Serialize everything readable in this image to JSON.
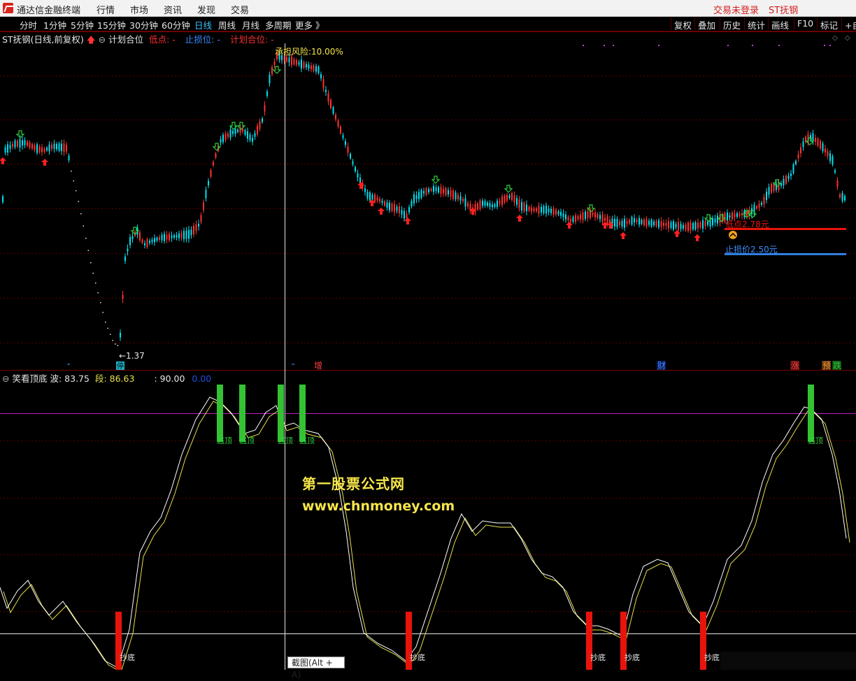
{
  "app": {
    "title": "通达信金融终端",
    "menu": [
      "行情",
      "市场",
      "资讯",
      "发现",
      "交易"
    ],
    "login_status": "交易未登录",
    "stock_name": "ST抚钢"
  },
  "timeframes": [
    "分时",
    "1分钟",
    "5分钟",
    "15分钟",
    "30分钟",
    "60分钟",
    "日线",
    "周线",
    "月线",
    "多周期",
    "更多 》"
  ],
  "active_timeframe": "日线",
  "tools": [
    "复权",
    "叠加",
    "历史",
    "统计",
    "画线",
    "F10",
    "标记",
    "+自"
  ],
  "main_panel": {
    "stock_label": "ST抚钢(日线,前复权)",
    "indicator_name": "计划合位",
    "low_label": "低点: -",
    "stop_label": "止损位: -",
    "plan_label": "计划合位: -",
    "top_annotation": "承担风险:10.00%",
    "min_annotation": "←1.37",
    "low_price_label": "低点2.78元",
    "stop_price_label": "止损价2.50元",
    "event_tags": [
      {
        "text": "停",
        "color": "#1ab0c4"
      },
      {
        "text": "增",
        "color": "#ff4040"
      },
      {
        "text": "财",
        "color": "#3b8cff"
      },
      {
        "text": "涨",
        "color": "#ff4040"
      },
      {
        "text": "预",
        "color": "#ff9933"
      },
      {
        "text": "跌",
        "color": "#2ed03a"
      }
    ],
    "candles_color_up": "#ff3232",
    "candles_color_down": "#00e0f0"
  },
  "sub_panel": {
    "indicator_name": "笑看顶底",
    "wave_label": "波:",
    "wave_value": "83.75",
    "segment_label": "段:",
    "segment_value": "86.63",
    "level_label": ": 90.00",
    "zero_label": "0.00",
    "top_signal_text": "逃顶",
    "bottom_signal_text": "抄底",
    "line_wave_color": "#ffffff",
    "line_segment_color": "#e6e04a",
    "top_bar_color": "#34c234",
    "bottom_bar_color": "#e8140c",
    "level_line_color": "#c020c0"
  },
  "watermark": {
    "line1": "第一股票公式网",
    "line2": "www.chnmoney.com"
  },
  "tooltip": "截图(Alt + A)"
}
